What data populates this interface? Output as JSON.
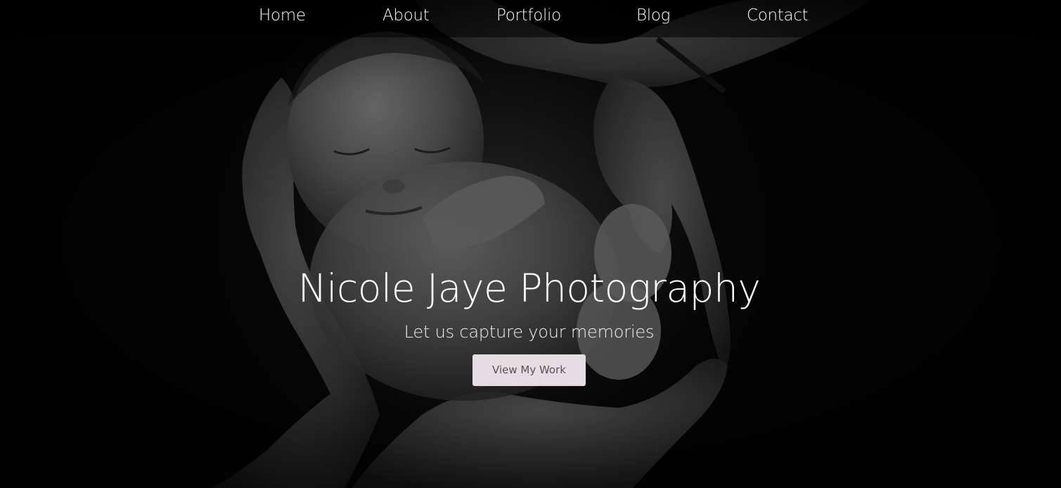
{
  "nav": {
    "items": [
      {
        "label": "Home"
      },
      {
        "label": "About"
      },
      {
        "label": "Portfolio"
      },
      {
        "label": "Blog"
      },
      {
        "label": "Contact"
      }
    ]
  },
  "hero": {
    "title": "Nicole Jaye Photography",
    "subtitle": "Let us capture your memories",
    "cta_label": "View My Work",
    "image_icon": "photo-hero-image"
  },
  "colors": {
    "background": "#050505",
    "nav_overlay": "#000000",
    "text": "#ffffff",
    "button_bg": "#e6dde2",
    "button_text": "#555555"
  }
}
